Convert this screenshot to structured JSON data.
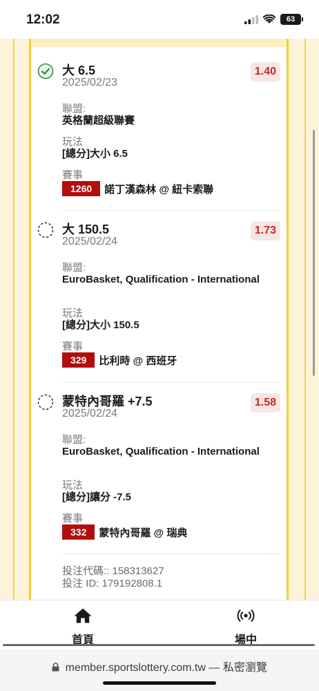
{
  "status_bar": {
    "time": "12:02",
    "battery": "63"
  },
  "bets": [
    {
      "status": "won",
      "title": "大 6.5",
      "date": "2025/02/23",
      "odds": "1.40",
      "league_label": "聯盟:",
      "league": "英格蘭超級聯賽",
      "play_label": "玩法",
      "play": "[總分]大小 6.5",
      "match_label": "賽事",
      "match_code": "1260",
      "match_name": "諾丁漢森林 @ 紐卡索聯"
    },
    {
      "status": "pending",
      "title": "大 150.5",
      "date": "2025/02/24",
      "odds": "1.73",
      "league_label": "聯盟:",
      "league": "EuroBasket, Qualification - International",
      "play_label": "玩法",
      "play": "[總分]大小 150.5",
      "match_label": "賽事",
      "match_code": "329",
      "match_name": "比利時 @ 西班牙"
    },
    {
      "status": "pending",
      "title": "蒙特內哥羅 +7.5",
      "date": "2025/02/24",
      "odds": "1.58",
      "league_label": "聯盟:",
      "league": "EuroBasket, Qualification - International",
      "play_label": "玩法",
      "play": "[總分]讓分 -7.5",
      "match_label": "賽事",
      "match_code": "332",
      "match_name": "蒙特內哥羅 @ 瑞典"
    }
  ],
  "bet_info": {
    "code_line": "投注代碼:: 158313627",
    "id_line": "投注 ID: 179192808.1"
  },
  "bottom_nav": {
    "home_label": "首頁",
    "live_label": "場中"
  },
  "browser": {
    "url": "member.sportslottery.com.tw",
    "mode_text": "— 私密瀏覽"
  },
  "colors": {
    "accent_yellow": "#f5cf2c",
    "page_background": "#fdf3d8",
    "odds_text": "#c12a22",
    "match_code_bg": "#b30d0d",
    "won_green": "#2e8b3a"
  },
  "icons": {
    "won": "check-circle-icon",
    "pending": "dashed-circle-icon",
    "home": "home-icon",
    "live": "broadcast-icon",
    "lock": "lock-icon"
  }
}
